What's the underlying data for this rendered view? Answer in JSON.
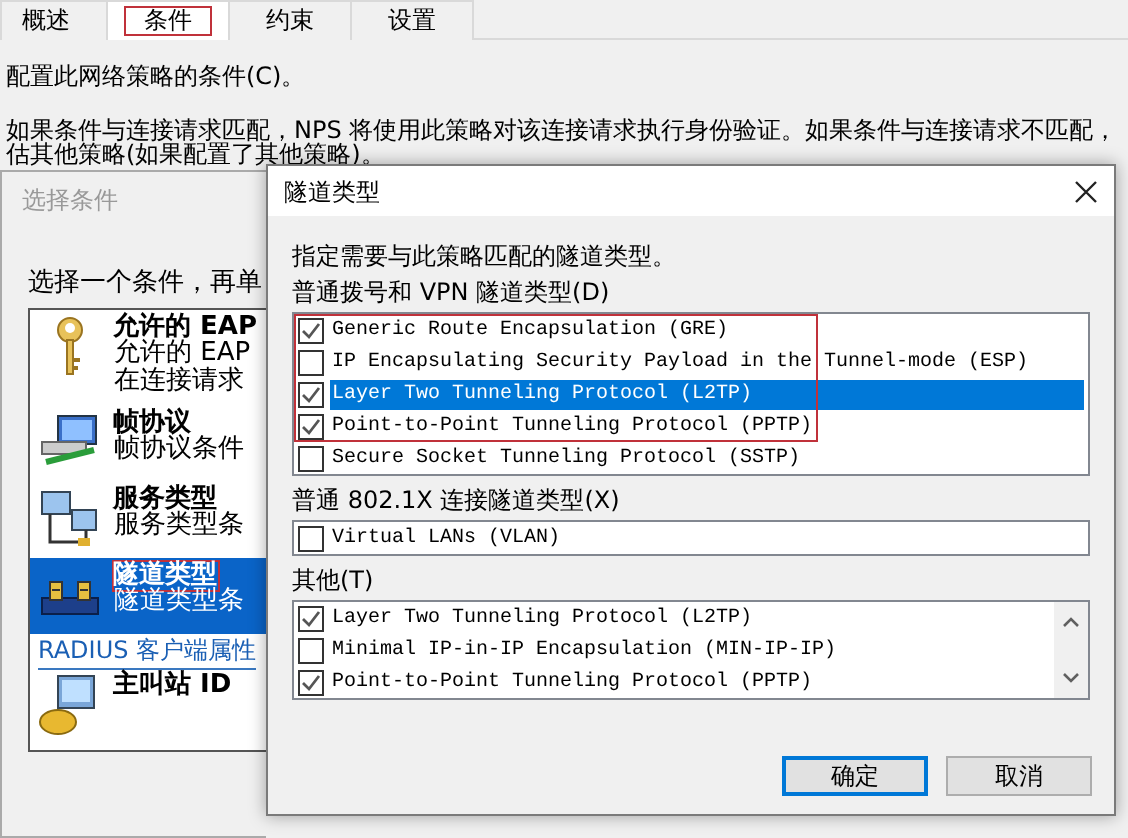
{
  "tabs": [
    {
      "label": "概述",
      "selected": false,
      "highlighted": false
    },
    {
      "label": "条件",
      "selected": true,
      "highlighted": true
    },
    {
      "label": "约束",
      "selected": false,
      "highlighted": false
    },
    {
      "label": "设置",
      "selected": false,
      "highlighted": false
    }
  ],
  "page": {
    "heading": "配置此网络策略的条件(C)。",
    "description_lines": [
      "如果条件与连接请求匹配，NPS 将使用此策略对该连接请求执行身份验证。如果条件与连接请求不匹配，",
      "估其他策略(如果配置了其他策略)。"
    ]
  },
  "select_condition_dialog": {
    "title": "选择条件",
    "prompt": "选择一个条件，再单",
    "items": [
      {
        "kind": "condition",
        "title": "允许的 EAP",
        "lines": [
          "允许的 EAP",
          "在连接请求"
        ],
        "selected": false,
        "highlighted": false
      },
      {
        "kind": "condition",
        "title": "帧协议",
        "lines": [
          "帧协议条件"
        ],
        "selected": false,
        "highlighted": false
      },
      {
        "kind": "condition",
        "title": "服务类型",
        "lines": [
          "服务类型条"
        ],
        "selected": false,
        "highlighted": false
      },
      {
        "kind": "condition",
        "title": "隧道类型",
        "lines": [
          "隧道类型条"
        ],
        "selected": true,
        "highlighted": true
      },
      {
        "kind": "group",
        "title": "RADIUS 客户端属性"
      },
      {
        "kind": "condition",
        "title": "主叫站 ID",
        "selected": false,
        "highlighted": false
      }
    ]
  },
  "tunnel_dialog": {
    "title": "隧道类型",
    "instruction": "指定需要与此策略匹配的隧道类型。",
    "groups": [
      {
        "label": "普通拨号和 VPN 隧道类型(D)",
        "scrollbar": false,
        "items": [
          {
            "label": "Generic Route Encapsulation (GRE)",
            "checked": true,
            "selected": false,
            "highlighted": true
          },
          {
            "label": "IP Encapsulating Security Payload in the Tunnel-mode (ESP)",
            "checked": false,
            "selected": false,
            "highlighted": true
          },
          {
            "label": "Layer Two Tunneling Protocol (L2TP)",
            "checked": true,
            "selected": true,
            "highlighted": true
          },
          {
            "label": "Point-to-Point Tunneling Protocol (PPTP)",
            "checked": true,
            "selected": false,
            "highlighted": true
          },
          {
            "label": "Secure Socket Tunneling Protocol (SSTP)",
            "checked": false,
            "selected": false,
            "highlighted": false
          }
        ]
      },
      {
        "label": "普通 802.1X 连接隧道类型(X)",
        "scrollbar": false,
        "items": [
          {
            "label": "Virtual LANs (VLAN)",
            "checked": false,
            "selected": false,
            "highlighted": false
          }
        ]
      },
      {
        "label": "其他(T)",
        "scrollbar": true,
        "items": [
          {
            "label": "Layer Two Tunneling Protocol (L2TP)",
            "checked": true,
            "selected": false,
            "highlighted": false
          },
          {
            "label": "Minimal IP-in-IP Encapsulation (MIN-IP-IP)",
            "checked": false,
            "selected": false,
            "highlighted": false
          },
          {
            "label": "Point-to-Point Tunneling Protocol (PPTP)",
            "checked": true,
            "selected": false,
            "highlighted": false
          }
        ]
      }
    ],
    "buttons": [
      {
        "label": "确定",
        "default": true
      },
      {
        "label": "取消",
        "default": false
      }
    ]
  }
}
